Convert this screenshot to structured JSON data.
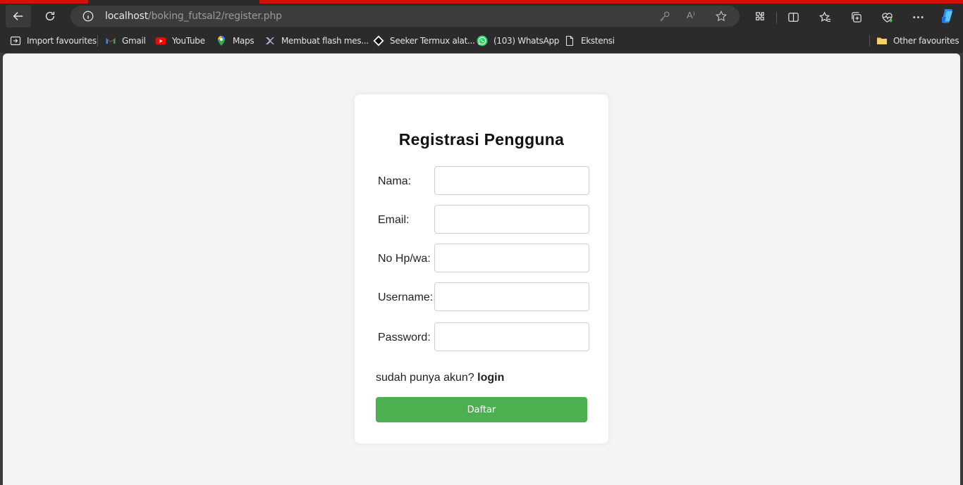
{
  "browser": {
    "url_host": "localhost",
    "url_path": "/boking_futsal2/register.php",
    "read_aloud": "A⁾",
    "accent_color": "#d40f0f"
  },
  "bookmarks": {
    "items": [
      {
        "label": "Import favourites",
        "icon": "import-icon"
      },
      {
        "label": "Gmail",
        "icon": "gmail-icon"
      },
      {
        "label": "YouTube",
        "icon": "youtube-icon"
      },
      {
        "label": "Maps",
        "icon": "maps-icon"
      },
      {
        "label": "Membuat flash mes...",
        "icon": "site-icon"
      },
      {
        "label": "Seeker Termux alat...",
        "icon": "diamond-icon"
      },
      {
        "label": "(103) WhatsApp",
        "icon": "whatsapp-icon"
      },
      {
        "label": "Ekstensi",
        "icon": "document-icon"
      }
    ],
    "other": "Other favourites"
  },
  "form": {
    "title": "Registrasi Pengguna",
    "fields": [
      {
        "label": "Nama:",
        "value": ""
      },
      {
        "label": "Email:",
        "value": ""
      },
      {
        "label": "No Hp/wa:",
        "value": ""
      },
      {
        "label": "Username:",
        "value": ""
      },
      {
        "label": "Password:",
        "value": ""
      }
    ],
    "login_prompt": "sudah punya akun?",
    "login_link": "login",
    "submit_label": "Daftar",
    "submit_color": "#4caf50"
  }
}
